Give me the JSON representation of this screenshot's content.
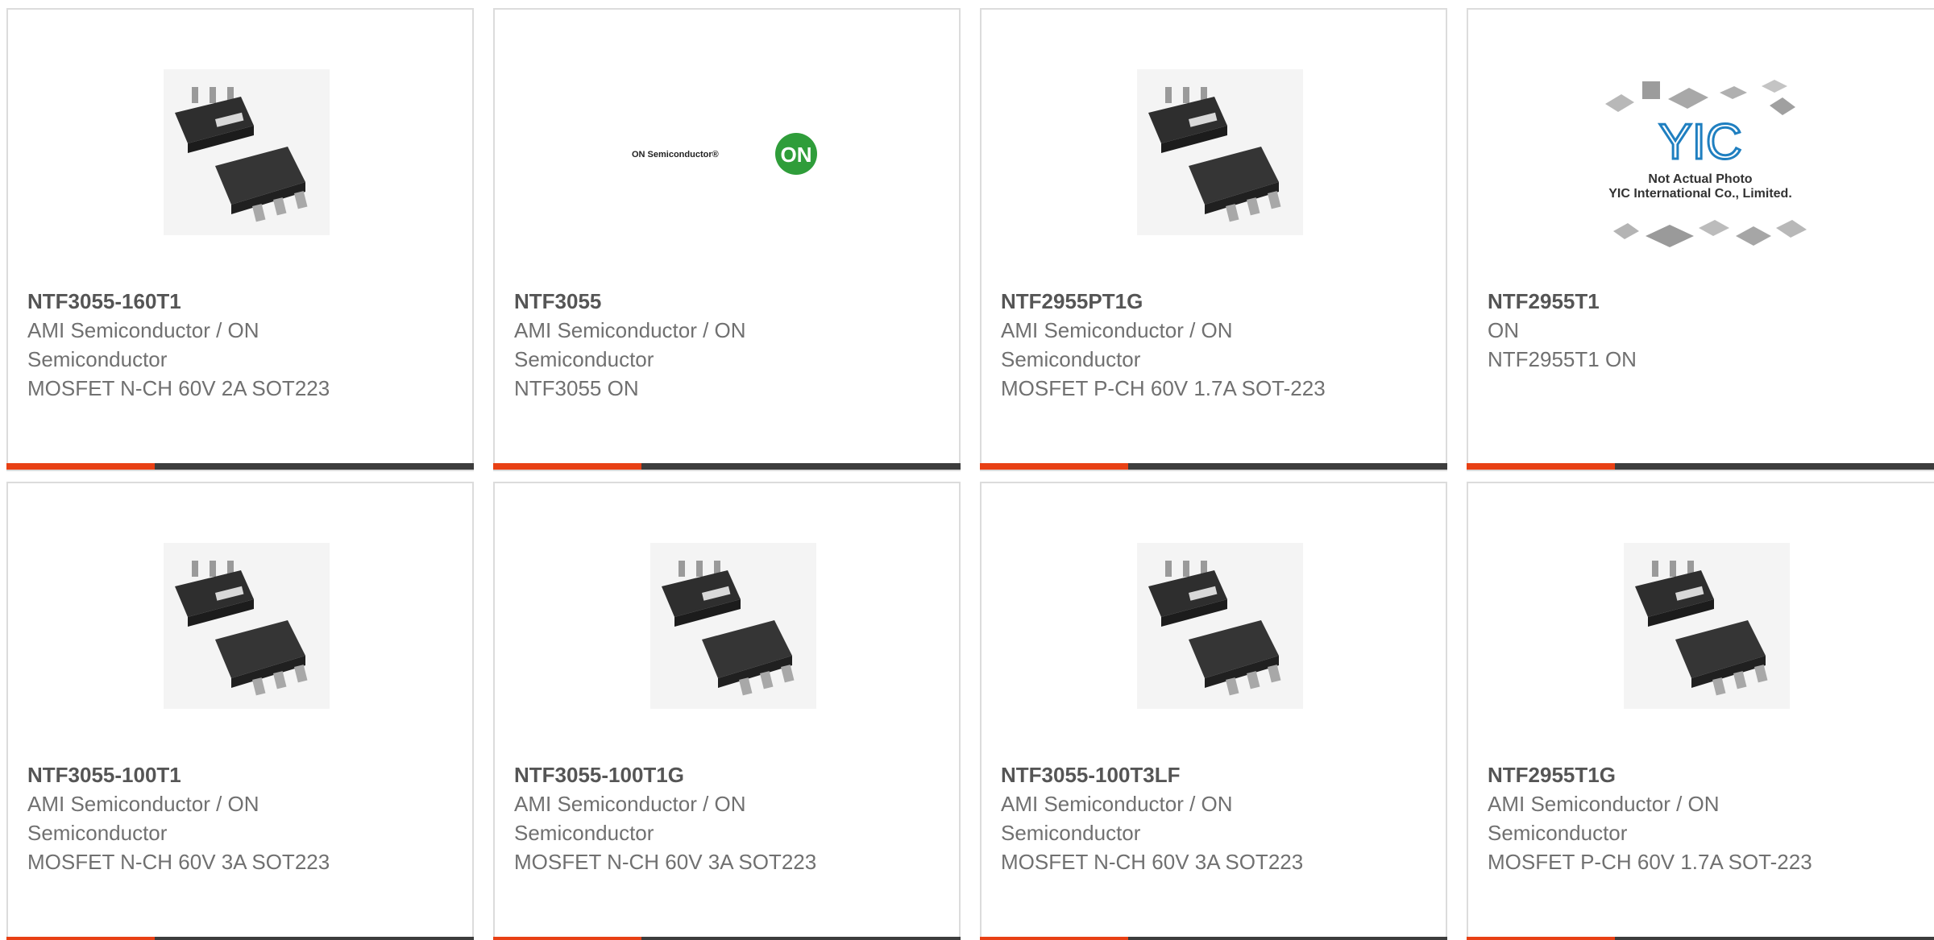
{
  "products": [
    {
      "part_number": "NTF3055-160T1",
      "manufacturer": "AMI Semiconductor / ON Semiconductor",
      "description": "MOSFET N-CH 60V 2A SOT223",
      "image": "sot223-package-photo"
    },
    {
      "part_number": "NTF3055",
      "manufacturer": "AMI Semiconductor / ON Semiconductor",
      "description": "NTF3055 ON",
      "image": "on-semiconductor-logo",
      "logo_text": "ON Semiconductor®",
      "logo_badge": "ON"
    },
    {
      "part_number": "NTF2955PT1G",
      "manufacturer": "AMI Semiconductor / ON Semiconductor",
      "description": "MOSFET P-CH 60V 1.7A SOT-223",
      "image": "sot223-package-photo"
    },
    {
      "part_number": "NTF2955T1",
      "manufacturer": "ON",
      "description": "NTF2955T1 ON",
      "image": "yic-placeholder",
      "placeholder_brand": "YIC",
      "placeholder_line1": "Not Actual Photo",
      "placeholder_line2": "YIC International Co., Limited."
    },
    {
      "part_number": "NTF3055-100T1",
      "manufacturer": "AMI Semiconductor / ON Semiconductor",
      "description": "MOSFET N-CH 60V 3A SOT223",
      "image": "sot223-package-photo"
    },
    {
      "part_number": "NTF3055-100T1G",
      "manufacturer": "AMI Semiconductor / ON Semiconductor",
      "description": "MOSFET N-CH 60V 3A SOT223",
      "image": "sot223-package-photo"
    },
    {
      "part_number": "NTF3055-100T3LF",
      "manufacturer": "AMI Semiconductor / ON Semiconductor",
      "description": "MOSFET N-CH 60V 3A SOT223",
      "image": "sot223-package-photo"
    },
    {
      "part_number": "NTF2955T1G",
      "manufacturer": "AMI Semiconductor / ON Semiconductor",
      "description": "MOSFET P-CH 60V 1.7A SOT-223",
      "image": "sot223-package-photo"
    }
  ],
  "colors": {
    "accent": "#e84014",
    "bar": "#3d3d3d",
    "border": "#dcdcdc",
    "title": "#555555",
    "text": "#707070",
    "on_green": "#2f9d3a",
    "yic_blue": "#1f7fc0"
  }
}
